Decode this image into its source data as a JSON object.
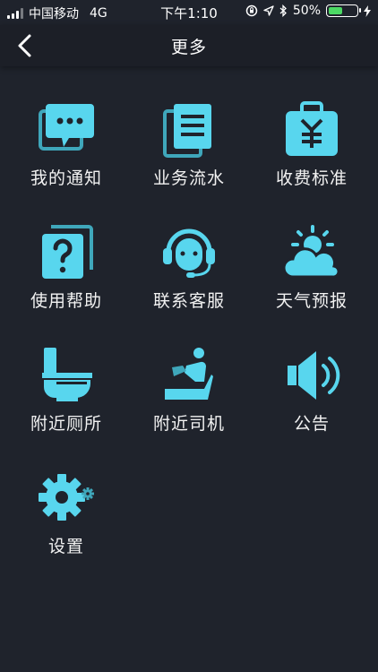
{
  "status_bar": {
    "carrier": "中国移动",
    "network": "4G",
    "time": "下午1:10",
    "battery": "50%",
    "battery_level": 0.5
  },
  "nav": {
    "title": "更多",
    "back_icon": "chevron-left-icon"
  },
  "colors": {
    "accent": "#58d6ee",
    "accent_dark": "#3fa7bb",
    "background": "#1f232c",
    "navbar": "#1c1f27",
    "battery_fill": "#4cd964"
  },
  "menu": [
    {
      "label": "我的通知",
      "icon": "notification-icon"
    },
    {
      "label": "业务流水",
      "icon": "business-record-icon"
    },
    {
      "label": "收费标准",
      "icon": "fee-standard-icon"
    },
    {
      "label": "使用帮助",
      "icon": "help-icon"
    },
    {
      "label": "联系客服",
      "icon": "customer-service-icon"
    },
    {
      "label": "天气预报",
      "icon": "weather-icon"
    },
    {
      "label": "附近厕所",
      "icon": "toilet-icon"
    },
    {
      "label": "附近司机",
      "icon": "driver-icon"
    },
    {
      "label": "公告",
      "icon": "announcement-icon"
    },
    {
      "label": "设置",
      "icon": "settings-icon"
    }
  ]
}
